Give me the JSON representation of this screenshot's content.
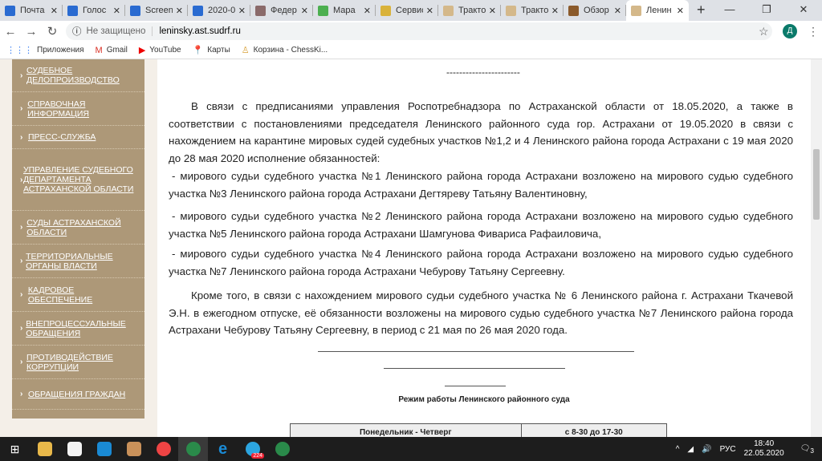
{
  "browser": {
    "tabs": [
      {
        "label": "Почта",
        "color": "#2a6bd1"
      },
      {
        "label": "Голос",
        "color": "#2a6bd1"
      },
      {
        "label": "Screen",
        "color": "#2a6bd1"
      },
      {
        "label": "2020-0",
        "color": "#2a6bd1"
      },
      {
        "label": "Федер",
        "color": "#8a6a6a"
      },
      {
        "label": "Мара",
        "color": "#4caf50"
      },
      {
        "label": "Сервис",
        "color": "#d9b23a"
      },
      {
        "label": "Тракто",
        "color": "#d4b88a"
      },
      {
        "label": "Тракто",
        "color": "#d4b88a"
      },
      {
        "label": "Обзор",
        "color": "#8b5a2b"
      },
      {
        "label": "Ленин",
        "color": "#d4b88a"
      }
    ],
    "new_tab": "+",
    "not_secure": "Не защищено",
    "url": "leninsky.ast.sudrf.ru",
    "profile_initial": "Д",
    "bookmarks": [
      {
        "label": "Приложения",
        "icon": "apps-icon"
      },
      {
        "label": "Gmail",
        "icon": "gmail-icon"
      },
      {
        "label": "YouTube",
        "icon": "youtube-icon"
      },
      {
        "label": "Карты",
        "icon": "maps-icon"
      },
      {
        "label": "Корзина - ChessKi...",
        "icon": "chess-icon"
      }
    ]
  },
  "sidebar": {
    "items": [
      "СУДЕБНОЕ ДЕЛОПРОИЗВОДСТВО",
      "СПРАВОЧНАЯ ИНФОРМАЦИЯ",
      "ПРЕСС-СЛУЖБА",
      "УПРАВЛЕНИЕ СУДЕБНОГО ДЕПАРТАМЕНТА АСТРАХАНСКОЙ ОБЛАСТИ",
      "СУДЫ АСТРАХАНСКОЙ ОБЛАСТИ",
      "ТЕРРИТОРИАЛЬНЫЕ ОРГАНЫ ВЛАСТИ",
      "КАДРОВОЕ ОБЕСПЕЧЕНИЕ",
      "ВНЕПРОЦЕССУАЛЬНЫЕ ОБРАЩЕНИЯ",
      "ПРОТИВОДЕЙСТВИЕ КОРРУПЦИИ",
      "ОБРАЩЕНИЯ ГРАЖДАН"
    ]
  },
  "content": {
    "separator": "-----------------------",
    "p1": "В связи с предписаниями управления Роспотребнадзора по Астраханской области от 18.05.2020, а также в соответствии с постановлениями председателя Ленинского районного суда гор. Астрахани от 19.05.2020 в связи с нахождением на карантине мировых судей судебных участков №1,2 и 4 Ленинского района города Астрахани с 19 мая 2020 до 28 мая 2020 исполнение обязанностей:",
    "p2": "- мирового судьи судебного участка №1 Ленинского района города Астрахани возложено на мирового судью судебного участка №3 Ленинского района города Астрахани Дегтяреву Татьяну Валентиновну,",
    "p3": "- мирового судьи судебного участка №2 Ленинского района города Астрахани возложено на мирового судью судебного участка №5 Ленинского района города Астрахани Шамгунова Фивариса Рафаиловича,",
    "p4": "- мирового судьи судебного участка №4 Ленинского района города Астрахани возложено на мирового судью судебного участка №7 Ленинского района города Астрахани Чебурову Татьяну Сергеевну.",
    "p5": "Кроме того, в связи с нахождением мирового судьи судебного участка № 6 Ленинского района г. Астрахани Ткачевой Э.Н. в ежегодном отпуске, её обязанности возложены на мирового судью судебного участка №7 Ленинского района города Астрахани Чебурову Татьяну Сергеевну, в период с 21 мая по 26 мая 2020 года.",
    "schedule_title": "Режим работы Ленинского районного суда",
    "schedule": [
      {
        "days": "Понедельник - Четверг",
        "hours": "с 8-30 до 17-30"
      }
    ]
  },
  "taskbar": {
    "telegram_badge": "224",
    "lang": "РУС",
    "time": "18:40",
    "date": "22.05.2020",
    "notifications": "3"
  }
}
